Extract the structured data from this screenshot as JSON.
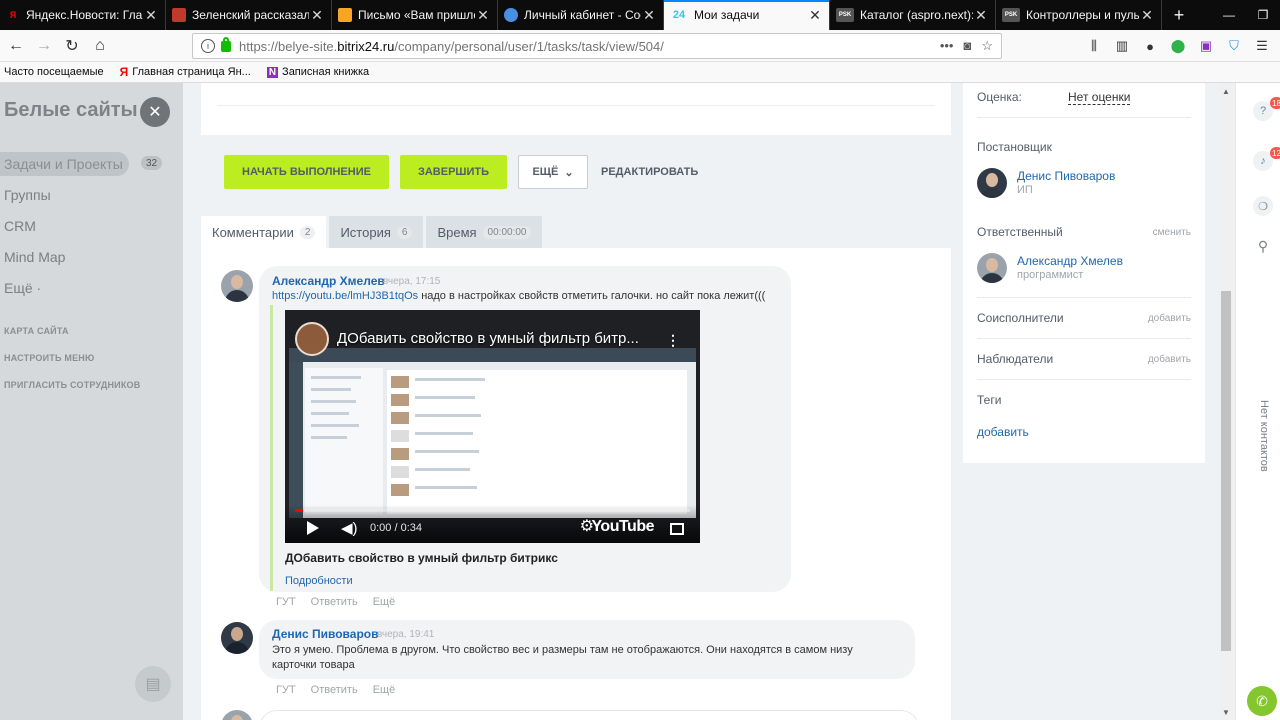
{
  "browser": {
    "tabs": [
      {
        "label": "Яндекс.Новости: Главн",
        "fav": "Я",
        "color": "#0c0c0d"
      },
      {
        "label": "Зеленский рассказал, к",
        "fav": "",
        "color": "#c0392b"
      },
      {
        "label": "Письмо «Вам пришло",
        "fav": "",
        "color": "#f5a623"
      },
      {
        "label": "Личный кабинет - Coo",
        "fav": "",
        "color": "#4a90e2"
      },
      {
        "label": "Мои задачи",
        "fav": "24",
        "color": "#2fc6f6"
      },
      {
        "label": "Каталог (aspro.next): Ин",
        "fav": "PSK",
        "color": "#333333"
      },
      {
        "label": "Контроллеры и пульты",
        "fav": "PSK",
        "color": "#333333"
      }
    ],
    "url_prefix": "https://belye-site.",
    "url_domain": "bitrix24.ru",
    "url_path": "/company/personal/user/1/tasks/task/view/504/",
    "bookmarks": [
      {
        "label": "Часто посещаемые",
        "icon": ""
      },
      {
        "label": "Главная страница Ян...",
        "icon": "Я"
      },
      {
        "label": "Записная книжка",
        "icon": "N"
      }
    ]
  },
  "sidebar": {
    "brand": "Белые сайты",
    "items": [
      {
        "label": "Задачи и Проекты",
        "count": "32"
      },
      {
        "label": "Группы"
      },
      {
        "label": "CRM"
      },
      {
        "label": "Mind Map"
      },
      {
        "label": "Ещё ·"
      }
    ],
    "links": [
      "КАРТА САЙТА",
      "НАСТРОИТЬ МЕНЮ",
      "ПРИГЛАСИТЬ СОТРУДНИКОВ"
    ]
  },
  "actions": {
    "start": "НАЧАТЬ ВЫПОЛНЕНИЕ",
    "finish": "ЗАВЕРШИТЬ",
    "more": "ЕЩЁ",
    "edit": "РЕДАКТИРОВАТЬ"
  },
  "tabs": [
    {
      "label": "Комментарии",
      "count": "2"
    },
    {
      "label": "История",
      "count": "6"
    },
    {
      "label": "Время",
      "count": "00:00:00"
    }
  ],
  "comments": [
    {
      "author": "Александр Хмелев",
      "time": "вчера, 17:15",
      "link": "https://youtu.be/lmHJ3B1tqOs",
      "text": " надо в настройках свойств отметить галочки. но сайт пока лежит(((",
      "video_title": "ДОбавить свойство в умный фильтр битрикс",
      "video_overlay_title": "ДОбавить свойство в умный фильтр битр...",
      "video_time": "0:00 / 0:34",
      "video_brand": "YouTube",
      "more": "Подробности",
      "actions": [
        "ГУТ",
        "Ответить",
        "Ещё"
      ]
    },
    {
      "author": "Денис Пивоваров",
      "time": "вчера, 19:41",
      "text": "Это я умею. Проблема в другом. Что свойство вес и размеры там не отображаются. Они находятся в самом низу карточки товара",
      "actions": [
        "ГУТ",
        "Ответить",
        "Ещё"
      ]
    }
  ],
  "rightpanel": {
    "rating_label": "Оценка:",
    "rating_value": "Нет оценки",
    "creator_label": "Постановщик",
    "creator_name": "Денис Пивоваров",
    "creator_role": "ИП",
    "responsible_label": "Ответственный",
    "responsible_change": "сменить",
    "responsible_name": "Александр Хмелев",
    "responsible_role": "программист",
    "coexec_label": "Соисполнители",
    "coexec_add": "добавить",
    "observers_label": "Наблюдатели",
    "observers_add": "добавить",
    "tags_label": "Теги",
    "tags_add": "добавить"
  },
  "rightbar": {
    "badge_help": "18",
    "badge_notify": "12",
    "contacts": "Нет контактов"
  }
}
